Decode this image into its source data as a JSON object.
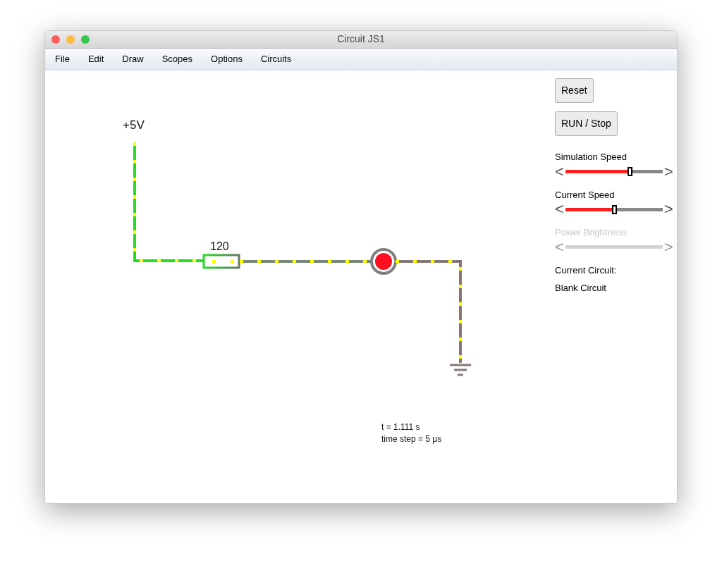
{
  "window": {
    "title": "Circuit JS1"
  },
  "menu": [
    "File",
    "Edit",
    "Draw",
    "Scopes",
    "Options",
    "Circuits"
  ],
  "buttons": [
    "Reset",
    "RUN / Stop"
  ],
  "sliders": [
    {
      "label": "Simulation Speed",
      "level": 0.66,
      "disabled": false,
      "left": "<",
      "right": ">"
    },
    {
      "label": "Current Speed",
      "level": 0.5,
      "disabled": false,
      "left": "<",
      "right": ">"
    },
    {
      "label": "Power Brightness",
      "disabled": true,
      "left": "<",
      "right": ">"
    }
  ],
  "current_circuit": {
    "label": "Current Circuit:",
    "value": "Blank Circuit"
  },
  "circuit": {
    "source_label": "+5V",
    "resistor_label": "120"
  },
  "status": [
    "t = 1.111 s",
    "time step = 5 µs"
  ]
}
